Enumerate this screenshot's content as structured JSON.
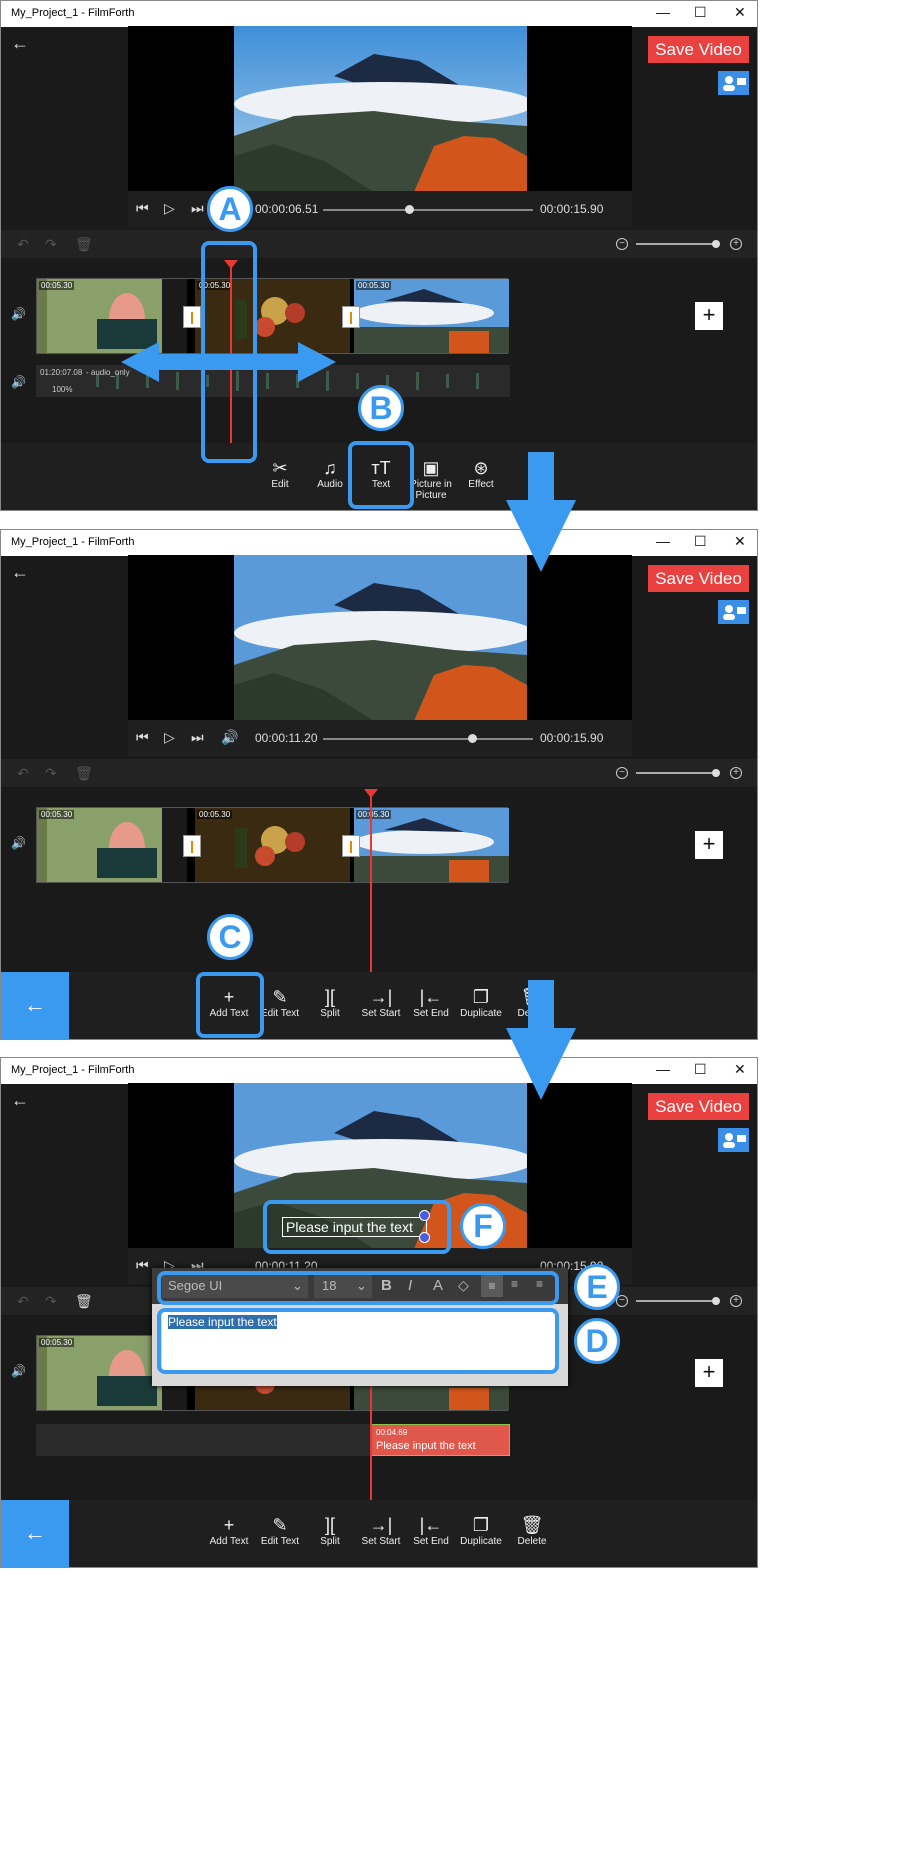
{
  "window": {
    "title": "My_Project_1 - FilmForth",
    "minimize": "—",
    "maximize": "☐",
    "close": "✕"
  },
  "header": {
    "back": "←",
    "save_label": "Save Video"
  },
  "panels": [
    {
      "current_time": "00:00:06.51",
      "total_time": "00:00:15.90",
      "progress": 0.41
    },
    {
      "current_time": "00:00:11.20",
      "total_time": "00:00:15.90",
      "progress": 0.71
    },
    {
      "current_time": "00:00:11.20",
      "total_time": "00:00:15.90",
      "progress": 0.71
    }
  ],
  "clips": {
    "duration": "00:05.30"
  },
  "audio_track": {
    "duration": "01:20:07.08",
    "name": "- audio_only",
    "volume": "100%"
  },
  "main_tools": [
    {
      "label": "Edit",
      "icon": "✂"
    },
    {
      "label": "Audio",
      "icon": "♫"
    },
    {
      "label": "Text",
      "icon": "ᴛT"
    },
    {
      "label": "Picture in Picture",
      "icon": "▣"
    },
    {
      "label": "Effect",
      "icon": "⊛"
    }
  ],
  "text_tools": [
    {
      "label": "Add Text",
      "icon": "+"
    },
    {
      "label": "Edit Text",
      "icon": "✎"
    },
    {
      "label": "Split",
      "icon": "]["
    },
    {
      "label": "Set Start",
      "icon": "→|"
    },
    {
      "label": "Set End",
      "icon": "|←"
    },
    {
      "label": "Duplicate",
      "icon": "❐"
    },
    {
      "label": "Delete",
      "icon": "🗑"
    }
  ],
  "text_overlay": {
    "placeholder": "Please input the text"
  },
  "text_editor": {
    "font": "Segoe UI",
    "size": "18",
    "bold": "B",
    "italic": "I",
    "color": "A",
    "text": "Please input the text"
  },
  "text_clip": {
    "duration": "00:04.69",
    "text": "Please input the text"
  },
  "markers": {
    "a": "A",
    "b": "B",
    "c": "C",
    "d": "D",
    "e": "E",
    "f": "F"
  },
  "colors": {
    "accent": "#3a9af0",
    "save": "#e8413f",
    "playhead": "#e53935",
    "text_clip": "#e0574c"
  }
}
